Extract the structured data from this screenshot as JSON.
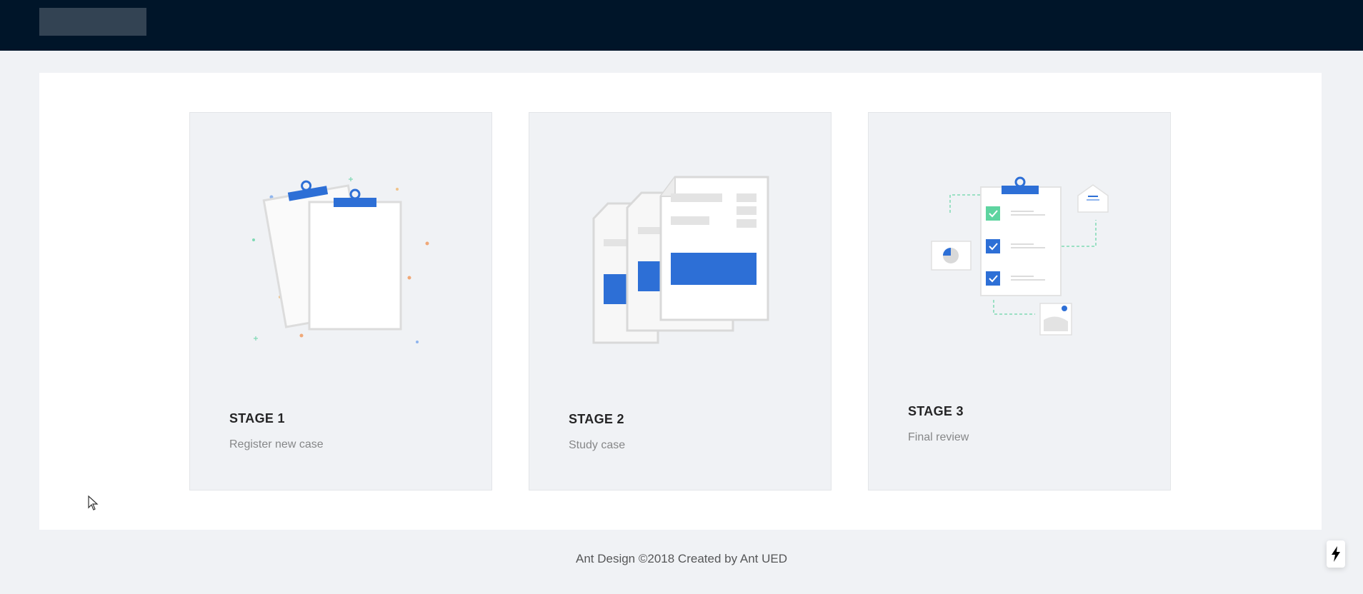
{
  "stages": [
    {
      "title": "STAGE 1",
      "description": "Register new case",
      "icon": "clipboards-illustration"
    },
    {
      "title": "STAGE 2",
      "description": "Study case",
      "icon": "documents-illustration"
    },
    {
      "title": "STAGE 3",
      "description": "Final review",
      "icon": "checklist-illustration"
    }
  ],
  "footer": {
    "text": "Ant Design ©2018 Created by Ant UED"
  },
  "colors": {
    "header": "#001529",
    "accent": "#2d6fd6",
    "card_bg": "#f0f2f5",
    "check_green": "#5ed4a0"
  }
}
